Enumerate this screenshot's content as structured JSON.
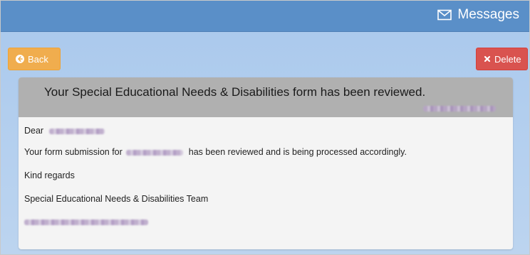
{
  "header": {
    "title": "Messages",
    "icon": "envelope-icon"
  },
  "toolbar": {
    "back_label": "Back",
    "back_icon": "arrow-left-circle-icon",
    "delete_label": "Delete",
    "delete_icon": "x-icon"
  },
  "message": {
    "subject": "Your Special Educational Needs & Disabilities form has been reviewed.",
    "greeting": "Dear",
    "body_prefix": "Your form submission for",
    "body_suffix": "has been reviewed and is being processed accordingly.",
    "closing": "Kind regards",
    "signature": "Special Educational Needs & Disabilities Team"
  },
  "colors": {
    "header": "#5a8fc8",
    "back_button": "#f0ad4e",
    "delete_button": "#d9534f",
    "card_header": "#b0b0b0",
    "card_body": "#f4f4f4"
  }
}
